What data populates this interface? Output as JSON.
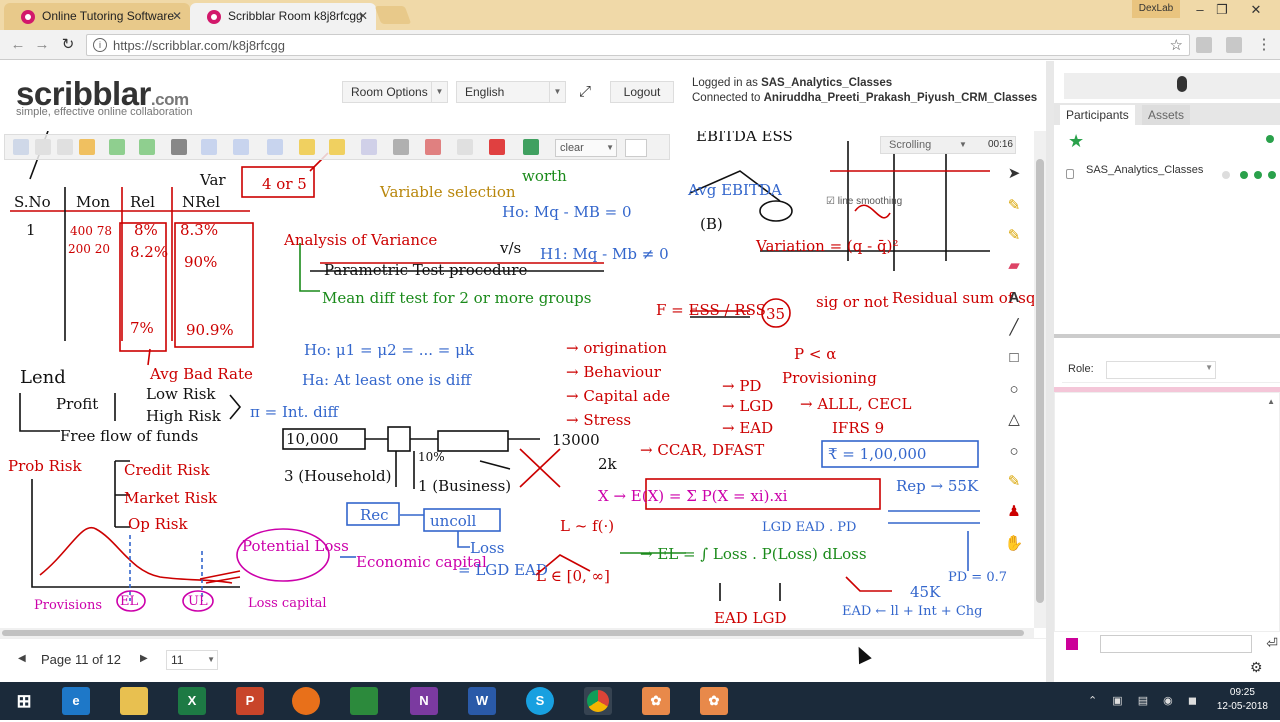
{
  "browser": {
    "tabs": [
      {
        "label": "Online Tutoring Software",
        "active": false
      },
      {
        "label": "Scribblar Room k8j8rfcgg",
        "active": true
      }
    ],
    "profile": "DexLab",
    "url": "https://scribblar.com/k8j8rfcgg"
  },
  "header": {
    "logo": "scribblar",
    "logo_suffix": ".com",
    "tagline": "simple, effective online collaboration",
    "room_options": "Room Options",
    "language": "English",
    "logout": "Logout",
    "logged_in_prefix": "Logged in as ",
    "logged_in_user": "SAS_Analytics_Classes",
    "connected_prefix": "Connected to ",
    "connected_room": "Aniruddha_Preeti_Prakash_Piyush_CRM_Classes"
  },
  "toolbar": {
    "clear_label": "clear",
    "scrolling_label": "Scrolling",
    "timer": "00:16",
    "line_smoothing": "line smoothing"
  },
  "pager": {
    "page_info": "Page 11 of 12",
    "page_select": "11"
  },
  "sidebar": {
    "tabs": [
      "Participants",
      "Assets"
    ],
    "participant_name": "SAS_Analytics_Classes",
    "role_label": "Role:"
  },
  "whiteboard_text": {
    "sno": "S.No",
    "mon": "Mon",
    "rel": "Rel",
    "nrel": "NRel",
    "var": "Var",
    "four_or_five": "4 or 5",
    "variable_selection": "Variable selection",
    "anova": "Analysis of Variance",
    "vs": "v/s",
    "h1": "H1: Mq - Mb ≠ 0",
    "h0": "Ho: Mq - MB = 0",
    "parametric": "Parametric Test procedure",
    "mean_diff": "Mean diff test for 2 or more groups",
    "ebitda": "EBITDA ESS",
    "worth": "worth",
    "avg_ebitda": "Avg EBITDA",
    "b": "(B)",
    "variation": "Variation = (q - q̄)²",
    "residual": "Residual sum of sq",
    "f_eq": "F = ESS / RSS",
    "f35": "35",
    "sig": "sig or not",
    "ho_mu": "Ho: μ1 = μ2 = ... = μk",
    "ha": "Ha: At least one is diff",
    "lend": "Lend",
    "profit": "Profit",
    "low_risk": "Low Risk",
    "high_risk": "High Risk",
    "pi": "π = Int. diff",
    "free_flow": "Free flow of funds",
    "origination": "→ origination",
    "behaviour": "→ Behaviour",
    "capital_ade": "→ Capital ade",
    "stress": "→ Stress",
    "ccar": "→ CCAR, DFAST",
    "pd": "→ PD",
    "lgd": "→ LGD",
    "ead": "→ EAD",
    "p_alpha": "P < α",
    "provisioning": "Provisioning",
    "alll": "→ ALLL, CECL",
    "ifrs9": "IFRS 9",
    "ten_k": "10,000",
    "thirteen_k": "13000",
    "household": "3 (Household)",
    "business": "1 (Business)",
    "ten_pct": "10%",
    "two_k": "2k",
    "budget": "₹ = 1,00,000",
    "rep": "Rep → 55K",
    "pd07": "PD = 0.7",
    "fortyfivek": "45K",
    "ex": "X → E(X) = Σ P(X = xi).xi",
    "prob_risk": "Prob Risk",
    "credit_risk": "Credit Risk",
    "market_risk": "Market Risk",
    "op_risk": "Op Risk",
    "rec": "Rec",
    "uncoll": "uncoll",
    "loss": "Loss",
    "potential_loss": "Potential Loss",
    "economic_capital": "Economic capital",
    "lgd_ead": "= LGD EAD",
    "l_f": "L ~ f(·)",
    "l_in": "L ∈ [0, ∞]",
    "el": "→ EL = ∫ Loss . P(Loss) dLoss",
    "lgd_ead_pd": "LGD EAD . PD",
    "ead_lgd": "EAD LGD",
    "ead_int": "EAD ← ll + Int + Chg",
    "provisions": "Provisions",
    "el_small": "EL",
    "ul": "UL",
    "loss_capital": "Loss capital",
    "one_row": "1",
    "r1": "400 78",
    "r2": "200 20",
    "p1": "8%",
    "p2": "8.2%",
    "p3": "7%",
    "n1": "8.3%",
    "n2": "90%",
    "n3": "90.9%",
    "avg_bad": "Avg Bad Rate"
  }
}
